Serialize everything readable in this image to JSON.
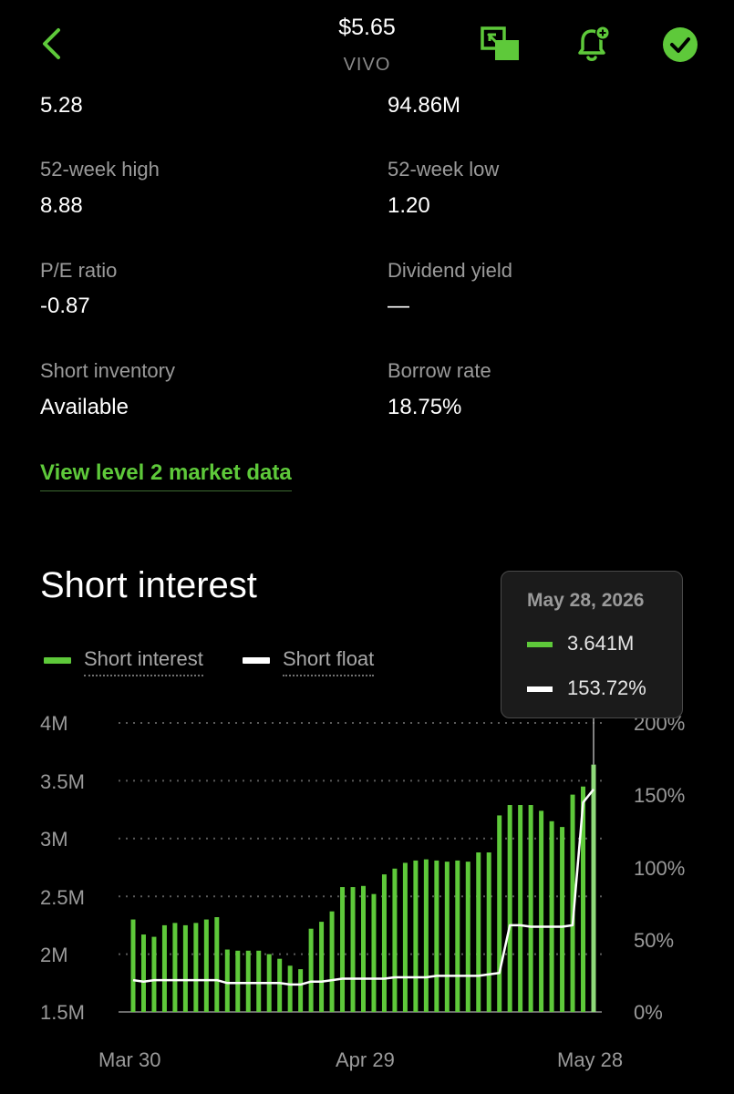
{
  "header": {
    "price": "$5.65",
    "ticker": "VIVO",
    "icons": [
      "back-chevron-icon",
      "picture-in-picture-icon",
      "add-alert-bell-icon",
      "watchlist-check-icon"
    ],
    "accent_color": "#5ec93a"
  },
  "stats": {
    "top_left_value": "5.28",
    "top_right_value": "94.86M",
    "high_52w": {
      "label": "52-week high",
      "value": "8.88"
    },
    "low_52w": {
      "label": "52-week low",
      "value": "1.20"
    },
    "pe_ratio": {
      "label": "P/E ratio",
      "value": "-0.87"
    },
    "dividend_yield": {
      "label": "Dividend yield",
      "value": "—"
    },
    "short_inventory": {
      "label": "Short inventory",
      "value": "Available"
    },
    "borrow_rate": {
      "label": "Borrow rate",
      "value": "18.75%"
    }
  },
  "level2_link": "View level 2 market data",
  "section_title": "Short interest",
  "legend": {
    "short_interest": "Short interest",
    "short_float": "Short float"
  },
  "tooltip": {
    "date": "May 28, 2026",
    "short_interest": "3.641M",
    "short_float": "153.72%"
  },
  "chart_data": {
    "type": "bar",
    "title": "Short interest",
    "x_tick_labels": [
      "Mar 30",
      "Apr 29",
      "May 28"
    ],
    "y_left_ticks": [
      "4M",
      "3.5M",
      "3M",
      "2.5M",
      "2M",
      "1.5M"
    ],
    "y_right_ticks": [
      "200%",
      "150%",
      "100%",
      "50%",
      "0%"
    ],
    "y_left_range": [
      1.5,
      4.0
    ],
    "y_right_range": [
      0,
      200
    ],
    "grid": true,
    "legend_position": "top-left",
    "colors": {
      "short_interest": "#5ec93a",
      "short_float": "#ffffff",
      "highlight_bar": "#8fd97a"
    },
    "series": [
      {
        "name": "Short interest",
        "unit": "M",
        "values": [
          2.3,
          2.17,
          2.15,
          2.25,
          2.27,
          2.25,
          2.27,
          2.3,
          2.32,
          2.04,
          2.03,
          2.03,
          2.03,
          2.0,
          1.96,
          1.9,
          1.87,
          2.22,
          2.28,
          2.37,
          2.58,
          2.58,
          2.59,
          2.52,
          2.69,
          2.74,
          2.79,
          2.81,
          2.82,
          2.81,
          2.8,
          2.81,
          2.8,
          2.88,
          2.88,
          3.2,
          3.29,
          3.29,
          3.29,
          3.24,
          3.15,
          3.1,
          3.38,
          3.45,
          3.64
        ]
      },
      {
        "name": "Short float",
        "unit": "%",
        "values": [
          22,
          21,
          22,
          22,
          22,
          22,
          22,
          22,
          22,
          20,
          20,
          20,
          20,
          20,
          20,
          19,
          19,
          21,
          21,
          22,
          23,
          23,
          23,
          23,
          23,
          24,
          24,
          24,
          24,
          25,
          25,
          25,
          25,
          25,
          26,
          27,
          60,
          60,
          59,
          59,
          59,
          59,
          60,
          145,
          154
        ]
      }
    ],
    "highlighted_index": 44
  }
}
